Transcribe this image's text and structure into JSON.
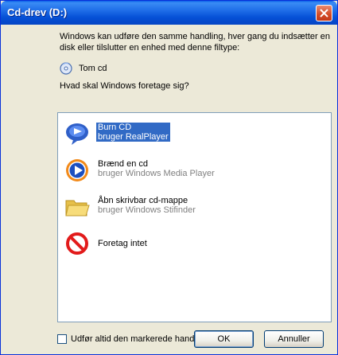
{
  "window": {
    "title": "Cd-drev (D:)"
  },
  "description": "Windows kan udføre den samme handling, hver gang du indsætter en disk eller tilslutter en enhed med denne filtype:",
  "media_type": "Tom cd",
  "question": "Hvad skal Windows foretage sig?",
  "actions": [
    {
      "label": "Burn CD",
      "sub": "bruger RealPlayer",
      "icon": "realplayer-icon",
      "selected": true
    },
    {
      "label": "Brænd en cd",
      "sub": "bruger Windows Media Player",
      "icon": "media-player-icon",
      "selected": false
    },
    {
      "label": "Åbn skrivbar cd-mappe",
      "sub": "bruger Windows Stifinder",
      "icon": "folder-icon",
      "selected": false
    },
    {
      "label": "Foretag intet",
      "sub": "",
      "icon": "no-action-icon",
      "selected": false
    }
  ],
  "always_checkbox": {
    "label": "Udfør altid den markerede handling.",
    "checked": false
  },
  "buttons": {
    "ok": "OK",
    "cancel": "Annuller"
  },
  "colors": {
    "titlebar": "#0550d6",
    "selection": "#316ac5",
    "dialog_bg": "#ece9d8"
  }
}
